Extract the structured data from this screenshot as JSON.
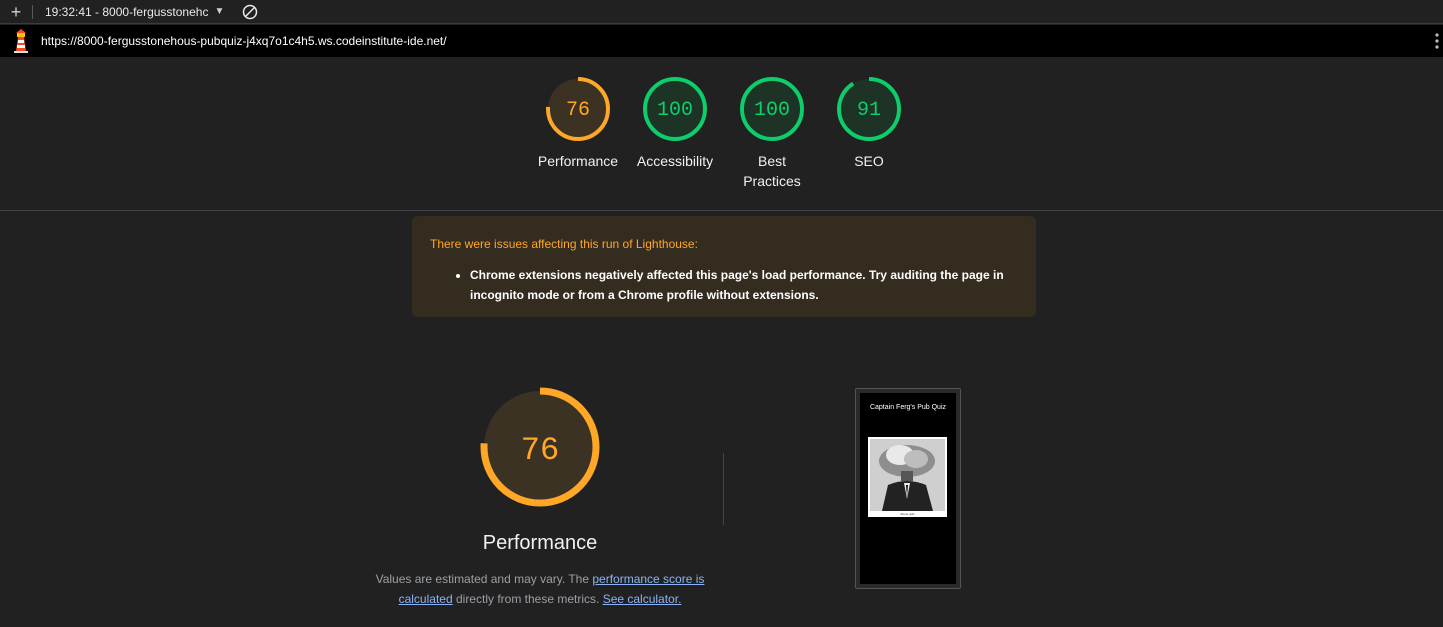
{
  "toolbar": {
    "new_label": "+",
    "run_label": "19:32:41 - 8000-fergusstonehc",
    "dropdown_caret": "▼"
  },
  "urlbar": {
    "url": "https://8000-fergusstonehous-pubquiz-j4xq7o1c4h5.ws.codeinstitute-ide.net/"
  },
  "gauges": [
    {
      "label": "Performance",
      "score": "76",
      "value": 76,
      "color": "#ffa726"
    },
    {
      "label": "Accessibility",
      "score": "100",
      "value": 100,
      "color": "#0cce6b"
    },
    {
      "label": "Best\nPractices",
      "score": "100",
      "value": 100,
      "color": "#0cce6b"
    },
    {
      "label": "SEO",
      "score": "91",
      "value": 91,
      "color": "#0cce6b"
    }
  ],
  "warning": {
    "title": "There were issues affecting this run of Lighthouse:",
    "items": [
      "Chrome extensions negatively affected this page's load performance. Try auditing the page in incognito mode or from a Chrome profile without extensions."
    ]
  },
  "performance": {
    "score": "76",
    "value": 76,
    "title": "Performance",
    "desc_prefix": "Values are estimated and may vary. The ",
    "desc_link1": "performance score is calculated",
    "desc_middle": " directly from these metrics. ",
    "desc_link2": "See calculator."
  },
  "thumbnail": {
    "title": "Captain Ferg's Pub Quiz",
    "caption": "Stone quiz"
  },
  "colors": {
    "average": "#ffa726",
    "pass": "#0cce6b",
    "average_bg": "#3b3224",
    "pass_bg": "#1c3326"
  }
}
